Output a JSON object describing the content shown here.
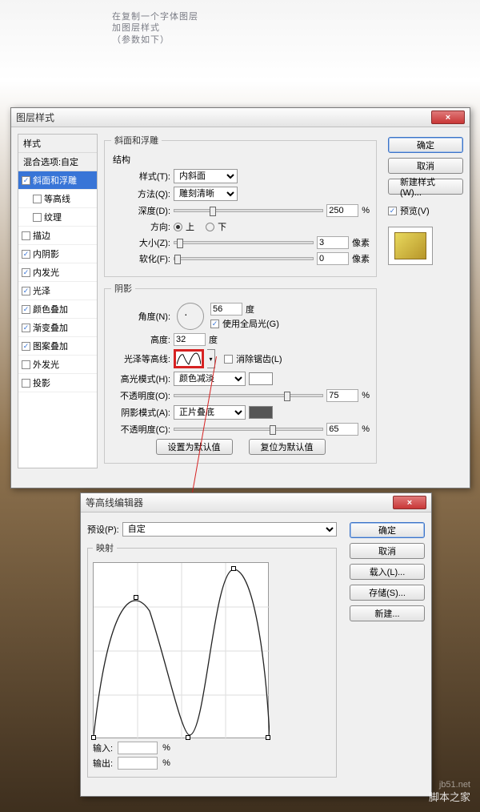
{
  "caption": {
    "line1": "在复制一个字体图层",
    "line2": "加图层样式",
    "line3": "（参数如下）"
  },
  "dialog1": {
    "title": "图层样式",
    "section_styles": "样式",
    "section_blend": "混合选项:自定",
    "styles": [
      "斜面和浮雕",
      "等高线",
      "纹理",
      "描边",
      "内阴影",
      "内发光",
      "光泽",
      "颜色叠加",
      "渐变叠加",
      "图案叠加",
      "外发光",
      "投影"
    ],
    "panel_title": "斜面和浮雕",
    "group_structure": "结构",
    "style_label": "样式(T):",
    "style_value": "内斜面",
    "method_label": "方法(Q):",
    "method_value": "雕刻清晰",
    "depth_label": "深度(D):",
    "depth_value": "250",
    "direction_label": "方向:",
    "dir_up": "上",
    "dir_down": "下",
    "size_label": "大小(Z):",
    "size_value": "3",
    "soften_label": "软化(F):",
    "soften_value": "0",
    "px": "像素",
    "pct": "%",
    "group_shading": "阴影",
    "angle_label": "角度(N):",
    "angle_value": "56",
    "deg": "度",
    "global_light": "使用全局光(G)",
    "altitude_label": "高度:",
    "altitude_value": "32",
    "gloss_label": "光泽等高线:",
    "antialias": "消除锯齿(L)",
    "hl_mode_label": "高光模式(H):",
    "hl_mode_value": "颜色减淡",
    "hl_opacity_label": "不透明度(O):",
    "hl_opacity_value": "75",
    "sh_mode_label": "阴影模式(A):",
    "sh_mode_value": "正片叠底",
    "sh_opacity_label": "不透明度(C):",
    "sh_opacity_value": "65",
    "btn_default": "设置为默认值",
    "btn_reset": "复位为默认值",
    "ok": "确定",
    "cancel": "取消",
    "new_style": "新建样式(W)...",
    "preview": "预览(V)"
  },
  "dialog2": {
    "title": "等高线编辑器",
    "preset_label": "预设(P):",
    "preset_value": "自定",
    "mapping": "映射",
    "input_label": "输入:",
    "output_label": "输出:",
    "pct": "%",
    "ok": "确定",
    "cancel": "取消",
    "load": "载入(L)...",
    "save": "存储(S)...",
    "new": "新建..."
  },
  "watermark1": "jb51.net",
  "watermark2": "脚本之家"
}
